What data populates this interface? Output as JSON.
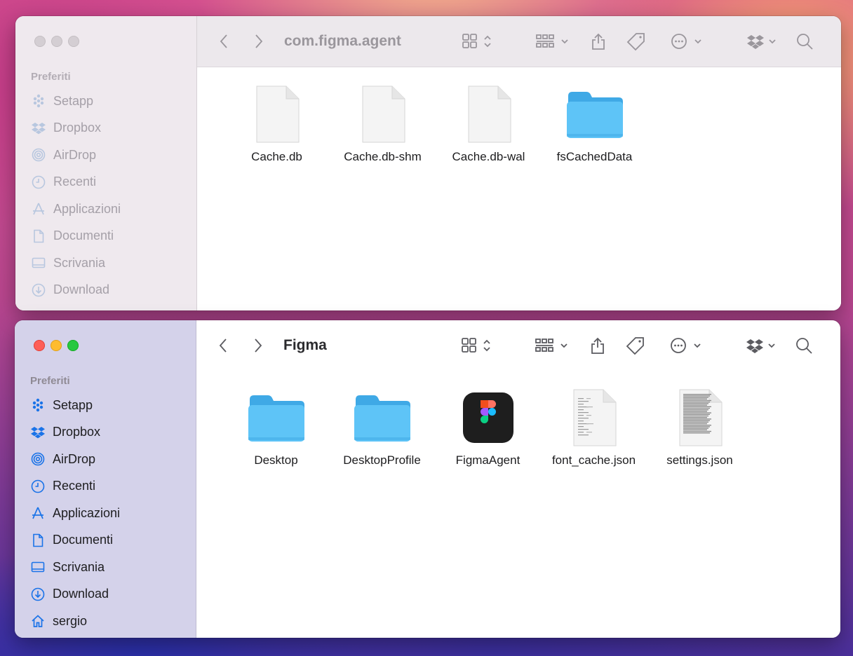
{
  "window_top": {
    "title": "com.figma.agent",
    "sidebar_heading": "Preferiti",
    "sidebar_items": [
      {
        "label": "Setapp",
        "icon": "setapp-icon"
      },
      {
        "label": "Dropbox",
        "icon": "dropbox-icon"
      },
      {
        "label": "AirDrop",
        "icon": "airdrop-icon"
      },
      {
        "label": "Recenti",
        "icon": "clock-icon"
      },
      {
        "label": "Applicazioni",
        "icon": "applications-icon"
      },
      {
        "label": "Documenti",
        "icon": "document-icon"
      },
      {
        "label": "Scrivania",
        "icon": "desktop-icon"
      },
      {
        "label": "Download",
        "icon": "download-icon"
      }
    ],
    "files": [
      {
        "name": "Cache.db",
        "kind": "blank-file"
      },
      {
        "name": "Cache.db-shm",
        "kind": "blank-file"
      },
      {
        "name": "Cache.db-wal",
        "kind": "blank-file"
      },
      {
        "name": "fsCachedData",
        "kind": "folder"
      }
    ]
  },
  "window_bottom": {
    "title": "Figma",
    "sidebar_heading": "Preferiti",
    "sidebar_items": [
      {
        "label": "Setapp",
        "icon": "setapp-icon"
      },
      {
        "label": "Dropbox",
        "icon": "dropbox-icon"
      },
      {
        "label": "AirDrop",
        "icon": "airdrop-icon"
      },
      {
        "label": "Recenti",
        "icon": "clock-icon"
      },
      {
        "label": "Applicazioni",
        "icon": "applications-icon"
      },
      {
        "label": "Documenti",
        "icon": "document-icon"
      },
      {
        "label": "Scrivania",
        "icon": "desktop-icon"
      },
      {
        "label": "Download",
        "icon": "download-icon"
      },
      {
        "label": "sergio",
        "icon": "home-icon"
      }
    ],
    "files": [
      {
        "name": "Desktop",
        "kind": "folder"
      },
      {
        "name": "DesktopProfile",
        "kind": "folder"
      },
      {
        "name": "FigmaAgent",
        "kind": "figma-app"
      },
      {
        "name": "font_cache.json",
        "kind": "text-file"
      },
      {
        "name": "settings.json",
        "kind": "dense-text-file"
      }
    ]
  },
  "colors": {
    "folder": "#5ec4f7",
    "accent": "#1a73e8",
    "close": "#fe5f57",
    "minimize": "#febc2e",
    "zoom": "#28c840"
  }
}
